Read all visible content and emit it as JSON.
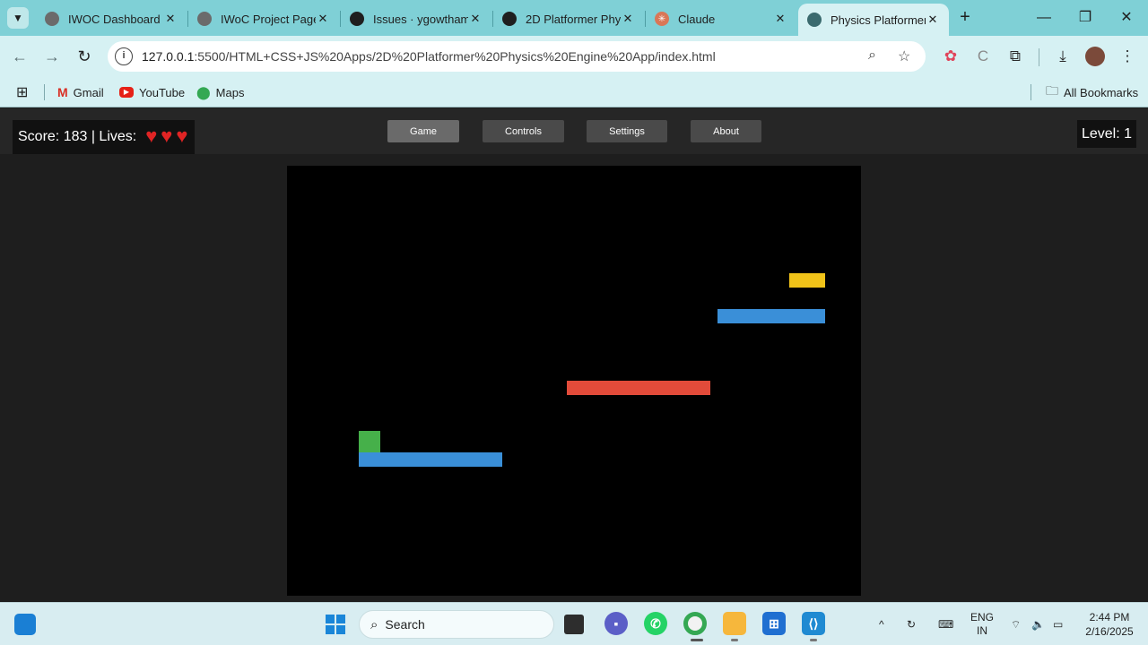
{
  "browser": {
    "tabs": [
      {
        "title": "IWOC Dashboard",
        "fav_color": "#6b6b6b",
        "active": false
      },
      {
        "title": "IWoC Project Page",
        "fav_color": "#6b6b6b",
        "active": false
      },
      {
        "title": "Issues · ygowtham",
        "fav_color": "#1f1f1f",
        "active": false
      },
      {
        "title": "2D Platformer Phy",
        "fav_color": "#1f1f1f",
        "active": false
      },
      {
        "title": "Claude",
        "fav_color": "#d97757",
        "active": false
      },
      {
        "title": "Physics Platformer",
        "fav_color": "#3a6a6e",
        "active": true
      }
    ],
    "url_host": "127.0.0.1",
    "url_rest": ":5500/HTML+CSS+JS%20Apps/2D%20Platformer%20Physics%20Engine%20App/index.html",
    "bookmarks": [
      {
        "label": "Gmail",
        "icon": "gmail-icon"
      },
      {
        "label": "YouTube",
        "icon": "youtube-icon"
      },
      {
        "label": "Maps",
        "icon": "maps-icon"
      }
    ],
    "all_bookmarks": "All Bookmarks"
  },
  "game": {
    "hud_text": "Score: 183 | Lives:",
    "lives": 3,
    "menu": {
      "game": "Game",
      "controls": "Controls",
      "settings": "Settings",
      "about": "About"
    },
    "active_menu": "Game",
    "level_text": "Level: 1",
    "colors": {
      "platform": "#3a8fd8",
      "moving_platform": "#e24b3a",
      "player": "#46b04a",
      "goal": "#f1c319",
      "canvas_bg": "#000000"
    }
  },
  "taskbar": {
    "search_placeholder": "Search",
    "language": "ENG",
    "region": "IN",
    "time": "2:44 PM",
    "date": "2/16/2025"
  }
}
